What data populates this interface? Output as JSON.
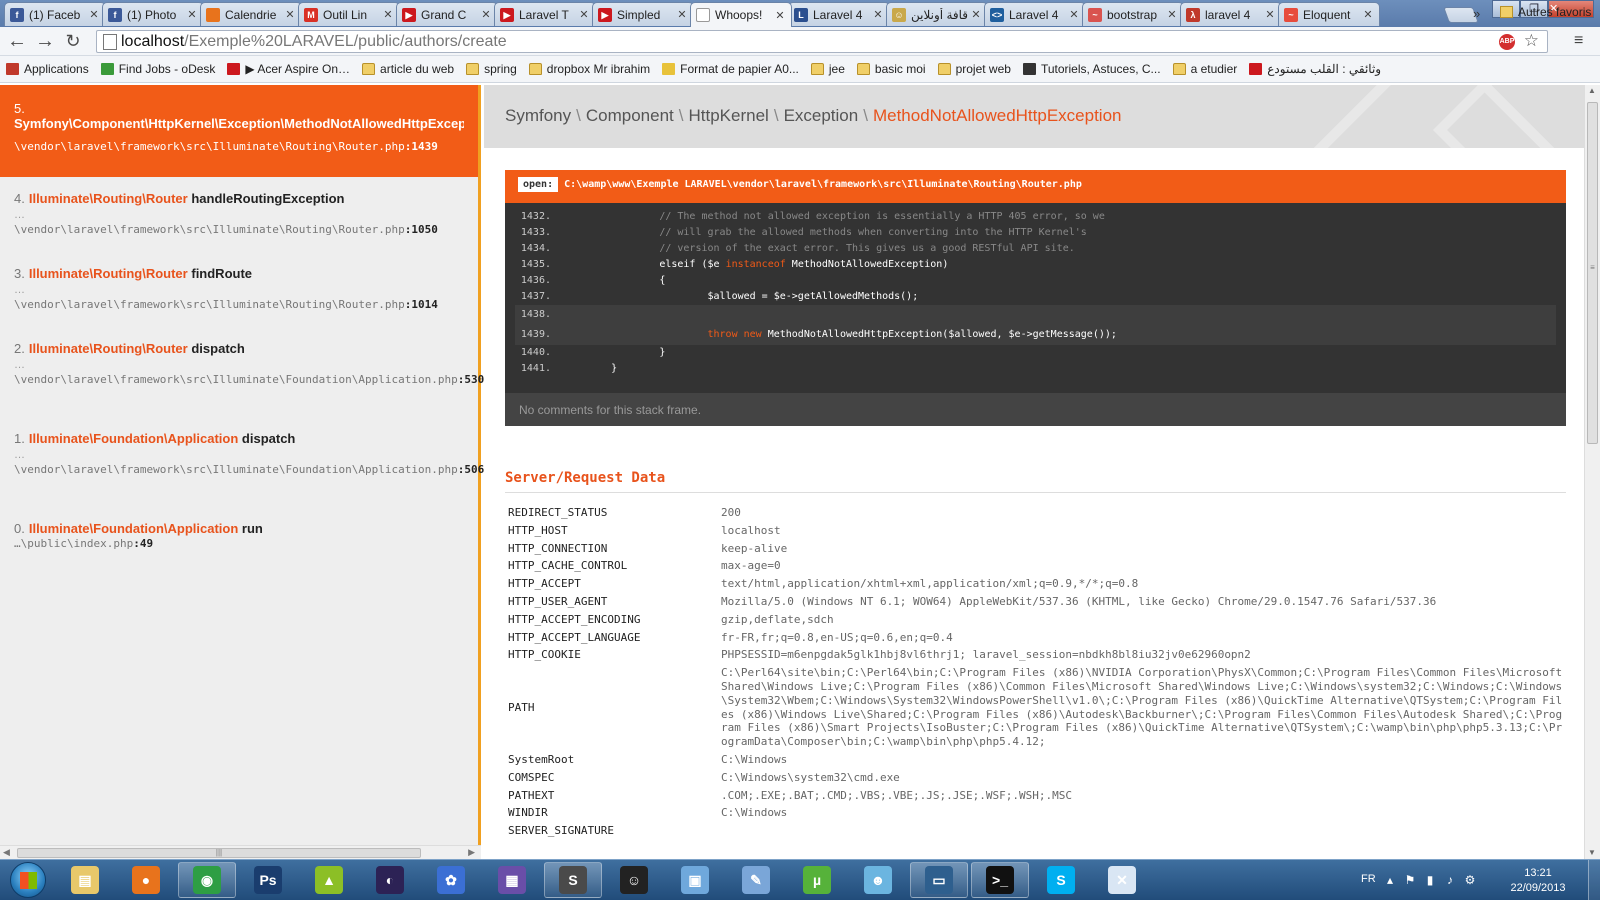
{
  "browser": {
    "tabs": [
      {
        "title": "(1) Faceb",
        "icon": "facebook-icon",
        "color": "#3b5998",
        "glyph": "f"
      },
      {
        "title": "(1) Photo",
        "icon": "facebook-icon",
        "color": "#3b5998",
        "glyph": "f"
      },
      {
        "title": "Calendrie",
        "icon": "calendar-icon",
        "color": "#e8731c",
        "glyph": ""
      },
      {
        "title": "Outil Lin",
        "icon": "gmail-icon",
        "color": "#d93025",
        "glyph": "M"
      },
      {
        "title": "Grand C",
        "icon": "youtube-icon",
        "color": "#cc181e",
        "glyph": "▶"
      },
      {
        "title": "Laravel T",
        "icon": "youtube-icon",
        "color": "#cc181e",
        "glyph": "▶"
      },
      {
        "title": "Simpled",
        "icon": "youtube-icon",
        "color": "#cc181e",
        "glyph": "▶"
      },
      {
        "title": "Whoops!",
        "icon": "page-icon",
        "color": "#ffffff",
        "glyph": "",
        "active": true
      },
      {
        "title": "Laravel 4",
        "icon": "laravel-icon",
        "color": "#2b4f8f",
        "glyph": "L"
      },
      {
        "title": "قافة أونلاين",
        "icon": "site-icon",
        "color": "#c9a84a",
        "glyph": "☺"
      },
      {
        "title": "Laravel 4",
        "icon": "code-icon",
        "color": "#1f5f9e",
        "glyph": "<>"
      },
      {
        "title": "bootstrap",
        "icon": "laravel-icon",
        "color": "#d9534f",
        "glyph": "~"
      },
      {
        "title": "laravel 4",
        "icon": "laravel-icon",
        "color": "#c0392b",
        "glyph": "λ"
      },
      {
        "title": "Eloquent",
        "icon": "laravel-icon",
        "color": "#e74c3c",
        "glyph": "~"
      }
    ],
    "url_host": "localhost",
    "url_path": "/Exemple%20LARAVEL/public/authors/create",
    "adblock_label": "ABP",
    "bookmarks": [
      {
        "label": "Applications",
        "icon": "apps-icon",
        "color": "#c0392b"
      },
      {
        "label": "Find Jobs - oDesk",
        "icon": "odesk-icon",
        "color": "#3a9a3a"
      },
      {
        "label": "▶ Acer Aspire On…",
        "icon": "youtube-icon",
        "color": "#cc181e"
      },
      {
        "label": "article du web",
        "icon": "folder-icon",
        "color": "folder"
      },
      {
        "label": "spring",
        "icon": "folder-icon",
        "color": "folder"
      },
      {
        "label": "dropbox Mr ibrahim",
        "icon": "folder-icon",
        "color": "folder"
      },
      {
        "label": "Format de papier A0...",
        "icon": "site-icon",
        "color": "#e8c23a"
      },
      {
        "label": "jee",
        "icon": "folder-icon",
        "color": "folder"
      },
      {
        "label": "basic moi",
        "icon": "folder-icon",
        "color": "folder"
      },
      {
        "label": "projet web",
        "icon": "folder-icon",
        "color": "folder"
      },
      {
        "label": "Tutoriels, Astuces, C...",
        "icon": "diamond-icon",
        "color": "#333333"
      },
      {
        "label": "a etudier",
        "icon": "folder-icon",
        "color": "folder"
      },
      {
        "label": "وثائقي : القلب مستودع",
        "icon": "youtube-icon",
        "color": "#cc181e"
      }
    ],
    "bookmarks_more": "»",
    "other_bookmarks": "Autres favoris"
  },
  "whoops": {
    "frames": [
      {
        "index": "5.",
        "cls": "Symfony\\Component\\HttpKernel\\Exception\\MethodNotAllowedHttpException",
        "method": "",
        "dots": "",
        "file": "\\vendor\\laravel\\framework\\src\\Illuminate\\Routing\\Router.php",
        "line": ":1439",
        "active": true
      },
      {
        "index": "4.",
        "cls": "Illuminate\\Routing\\Router",
        "method": "handleRoutingException",
        "dots": "…",
        "file": "\\vendor\\laravel\\framework\\src\\Illuminate\\Routing\\Router.php",
        "line": ":1050"
      },
      {
        "index": "3.",
        "cls": "Illuminate\\Routing\\Router",
        "method": "findRoute",
        "dots": "…",
        "file": "\\vendor\\laravel\\framework\\src\\Illuminate\\Routing\\Router.php",
        "line": ":1014"
      },
      {
        "index": "2.",
        "cls": "Illuminate\\Routing\\Router",
        "method": "dispatch",
        "dots": "…",
        "file": "\\vendor\\laravel\\framework\\src\\Illuminate\\Foundation\\Application.php",
        "line": ":530",
        "tall": true
      },
      {
        "index": "1.",
        "cls": "Illuminate\\Foundation\\Application",
        "method": "dispatch",
        "dots": "…",
        "file": "\\vendor\\laravel\\framework\\src\\Illuminate\\Foundation\\Application.php",
        "line": ":506",
        "tall": true
      },
      {
        "index": "0.",
        "cls": "Illuminate\\Foundation\\Application",
        "method": "run",
        "dots": "",
        "file": "…\\public\\index.php",
        "line": ":49"
      }
    ],
    "breadcrumb": [
      "Symfony",
      "Component",
      "HttpKernel",
      "Exception"
    ],
    "exception_name": "MethodNotAllowedHttpException",
    "open_label": "open:",
    "open_path": "C:\\wamp\\www\\Exemple LARAVEL\\vendor\\laravel\\framework\\src\\Illuminate\\Routing\\Router.php",
    "code_lines": [
      {
        "n": "1432.",
        "parts": [
          {
            "t": "                // The method not allowed exception is essentially a HTTP 405 error, so we",
            "c": "cm"
          }
        ]
      },
      {
        "n": "1433.",
        "parts": [
          {
            "t": "                // will grab the allowed methods when converting into the HTTP Kernel's",
            "c": "cm"
          }
        ]
      },
      {
        "n": "1434.",
        "parts": [
          {
            "t": "                // version of the exact error. This gives us a good RESTful API site.",
            "c": "cm"
          }
        ]
      },
      {
        "n": "1435.",
        "parts": [
          {
            "t": "                elseif ($e ",
            "c": ""
          },
          {
            "t": "instanceof",
            "c": "kw"
          },
          {
            "t": " MethodNotAllowedException)",
            "c": ""
          }
        ]
      },
      {
        "n": "1436.",
        "parts": [
          {
            "t": "                {",
            "c": ""
          }
        ]
      },
      {
        "n": "1437.",
        "parts": [
          {
            "t": "                        $allowed = $e->getAllowedMethods();",
            "c": ""
          }
        ]
      },
      {
        "n": "1438.",
        "parts": [
          {
            "t": "",
            "c": ""
          }
        ],
        "hl": true
      },
      {
        "n": "1439.",
        "parts": [
          {
            "t": "                        ",
            "c": ""
          },
          {
            "t": "throw new",
            "c": "kw"
          },
          {
            "t": " MethodNotAllowedHttpException($allowed, $e->getMessage());",
            "c": ""
          }
        ],
        "hl": true
      },
      {
        "n": "1440.",
        "parts": [
          {
            "t": "                }",
            "c": ""
          }
        ]
      },
      {
        "n": "1441.",
        "parts": [
          {
            "t": "        }",
            "c": ""
          }
        ]
      }
    ],
    "no_comments": "No comments for this stack frame.",
    "server_title": "Server/Request Data",
    "server_rows": [
      {
        "k": "REDIRECT_STATUS",
        "v": "200"
      },
      {
        "k": "HTTP_HOST",
        "v": "localhost"
      },
      {
        "k": "HTTP_CONNECTION",
        "v": "keep-alive"
      },
      {
        "k": "HTTP_CACHE_CONTROL",
        "v": "max-age=0"
      },
      {
        "k": "HTTP_ACCEPT",
        "v": "text/html,application/xhtml+xml,application/xml;q=0.9,*/*;q=0.8"
      },
      {
        "k": "HTTP_USER_AGENT",
        "v": "Mozilla/5.0 (Windows NT 6.1; WOW64) AppleWebKit/537.36 (KHTML, like Gecko) Chrome/29.0.1547.76 Safari/537.36"
      },
      {
        "k": "HTTP_ACCEPT_ENCODING",
        "v": "gzip,deflate,sdch"
      },
      {
        "k": "HTTP_ACCEPT_LANGUAGE",
        "v": "fr-FR,fr;q=0.8,en-US;q=0.6,en;q=0.4"
      },
      {
        "k": "HTTP_COOKIE",
        "v": "PHPSESSID=m6enpgdak5glk1hbj8vl6thrj1; laravel_session=nbdkh8bl8iu32jv0e62960opn2"
      },
      {
        "k": "PATH",
        "v": "C:\\Perl64\\site\\bin;C:\\Perl64\\bin;C:\\Program Files (x86)\\NVIDIA Corporation\\PhysX\\Common;C:\\Program Files\\Common Files\\Microsoft Shared\\Windows Live;C:\\Program Files (x86)\\Common Files\\Microsoft Shared\\Windows Live;C:\\Windows\\system32;C:\\Windows;C:\\Windows\\System32\\Wbem;C:\\Windows\\System32\\WindowsPowerShell\\v1.0\\;C:\\Program Files (x86)\\QuickTime Alternative\\QTSystem;C:\\Program Files (x86)\\Windows Live\\Shared;C:\\Program Files (x86)\\Autodesk\\Backburner\\;C:\\Program Files\\Common Files\\Autodesk Shared\\;C:\\Program Files (x86)\\Smart Projects\\IsoBuster;C:\\Program Files (x86)\\QuickTime Alternative\\QTSystem\\;C:\\wamp\\bin\\php\\php5.3.13;C:\\ProgramData\\Composer\\bin;C:\\wamp\\bin\\php\\php5.4.12;"
      },
      {
        "k": "SystemRoot",
        "v": "C:\\Windows"
      },
      {
        "k": "COMSPEC",
        "v": "C:\\Windows\\system32\\cmd.exe"
      },
      {
        "k": "PATHEXT",
        "v": ".COM;.EXE;.BAT;.CMD;.VBS;.VBE;.JS;.JSE;.WSF;.WSH;.MSC"
      },
      {
        "k": "WINDIR",
        "v": "C:\\Windows"
      },
      {
        "k": "SERVER_SIGNATURE",
        "v": ""
      }
    ]
  },
  "taskbar": {
    "items": [
      {
        "name": "explorer-icon",
        "color": "#e8c86a",
        "glyph": "▤"
      },
      {
        "name": "firefox-icon",
        "color": "#e8731c",
        "glyph": "●"
      },
      {
        "name": "chrome-icon",
        "color": "#2e9e44",
        "glyph": "◉",
        "open": true
      },
      {
        "name": "photoshop-icon",
        "color": "#1a3d6e",
        "glyph": "Ps"
      },
      {
        "name": "android-sdk-icon",
        "color": "#8cbf26",
        "glyph": "▲"
      },
      {
        "name": "eclipse-icon",
        "color": "#2c2255",
        "glyph": "◐"
      },
      {
        "name": "app-icon",
        "color": "#3b6fd4",
        "glyph": "✿"
      },
      {
        "name": "visual-studio-icon",
        "color": "#6a4ea8",
        "glyph": "▦"
      },
      {
        "name": "sublime-text-icon",
        "color": "#4a4a4a",
        "glyph": "S",
        "open": true
      },
      {
        "name": "smiley-icon",
        "color": "#222222",
        "glyph": "☺"
      },
      {
        "name": "virtualbox-icon",
        "color": "#6fa8dc",
        "glyph": "▣"
      },
      {
        "name": "feather-icon",
        "color": "#7aa6d8",
        "glyph": "✎"
      },
      {
        "name": "utorrent-icon",
        "color": "#56b23a",
        "glyph": "µ"
      },
      {
        "name": "people-icon",
        "color": "#6bb5e0",
        "glyph": "☻"
      },
      {
        "name": "window-icon",
        "color": "#2e5f8e",
        "glyph": "▭",
        "open": true
      },
      {
        "name": "cmd-icon",
        "color": "#111111",
        "glyph": ">_",
        "open": true
      },
      {
        "name": "skype-icon",
        "color": "#00aff0",
        "glyph": "S"
      },
      {
        "name": "xampp-icon",
        "color": "#d9e6f4",
        "glyph": "✕"
      }
    ],
    "language": "FR",
    "time": "13:21",
    "date": "22/09/2013"
  }
}
